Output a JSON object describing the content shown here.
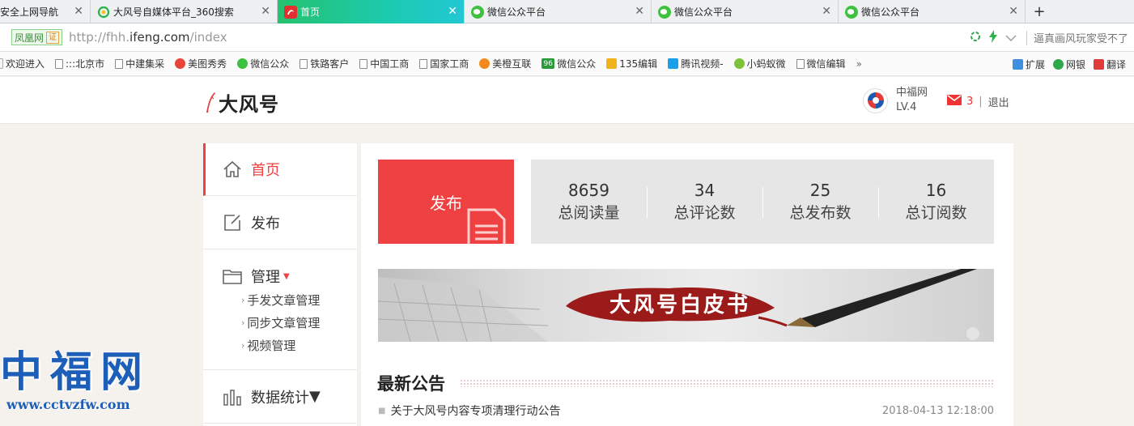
{
  "browser": {
    "tabs": [
      {
        "label": "安全上网导航",
        "icon": "safe-nav-icon",
        "active": false
      },
      {
        "label": "大风号自媒体平台_360搜索",
        "icon": "360-search-icon",
        "active": false
      },
      {
        "label": "首页",
        "icon": "ifeng-icon",
        "active": true
      },
      {
        "label": "微信公众平台",
        "icon": "wechat-icon",
        "active": false
      },
      {
        "label": "微信公众平台",
        "icon": "wechat-icon",
        "active": false
      },
      {
        "label": "微信公众平台",
        "icon": "wechat-icon",
        "active": false
      }
    ],
    "new_tab": "+",
    "close_glyph": "✕",
    "address": {
      "badge": "凤凰网",
      "badge_cert": "证",
      "url_prefix": "http://fhh.",
      "url_domain": "ifeng.com",
      "url_suffix": "/index",
      "search_hint": "逼真画风玩家受不了"
    },
    "bookmarks": [
      "欢迎进入",
      ":::北京市",
      "中建集采",
      "美图秀秀",
      "微信公众",
      "铁路客户",
      "中国工商",
      "国家工商",
      "美橙互联",
      "微信公众",
      "135编辑",
      "腾讯视频-",
      "小蚂蚁微",
      "微信编辑"
    ],
    "bookmark_more": "»",
    "bookmark_right": [
      "扩展",
      "网银",
      "翻译"
    ]
  },
  "header": {
    "logo_text": "大风号",
    "user_name": "中福网",
    "user_level": "LV.4",
    "mail_count": "3",
    "separator": "|",
    "logout": "退出"
  },
  "nav": {
    "home": "首页",
    "publish": "发布",
    "manage": "管理",
    "manage_sub": [
      "手发文章管理",
      "同步文章管理",
      "视频管理"
    ],
    "stats": "数据统计",
    "caret": "▼",
    "sub_arrow": "›"
  },
  "main": {
    "publish_button": "发布",
    "stats": [
      {
        "value": "8659",
        "label": "总阅读量"
      },
      {
        "value": "34",
        "label": "总评论数"
      },
      {
        "value": "25",
        "label": "总发布数"
      },
      {
        "value": "16",
        "label": "总订阅数"
      }
    ],
    "banner_title": "大风号白皮书",
    "news_title": "最新公告",
    "news": [
      {
        "title": "关于大风号内容专项清理行动公告",
        "date": "2018-04-13 12:18:00"
      }
    ]
  },
  "watermark": {
    "title": "中福网",
    "url": "www.cctvzfw.com"
  },
  "colors": {
    "accent": "#f04142",
    "tab_active": "#22c7a0",
    "watermark": "#1d5fb8"
  }
}
